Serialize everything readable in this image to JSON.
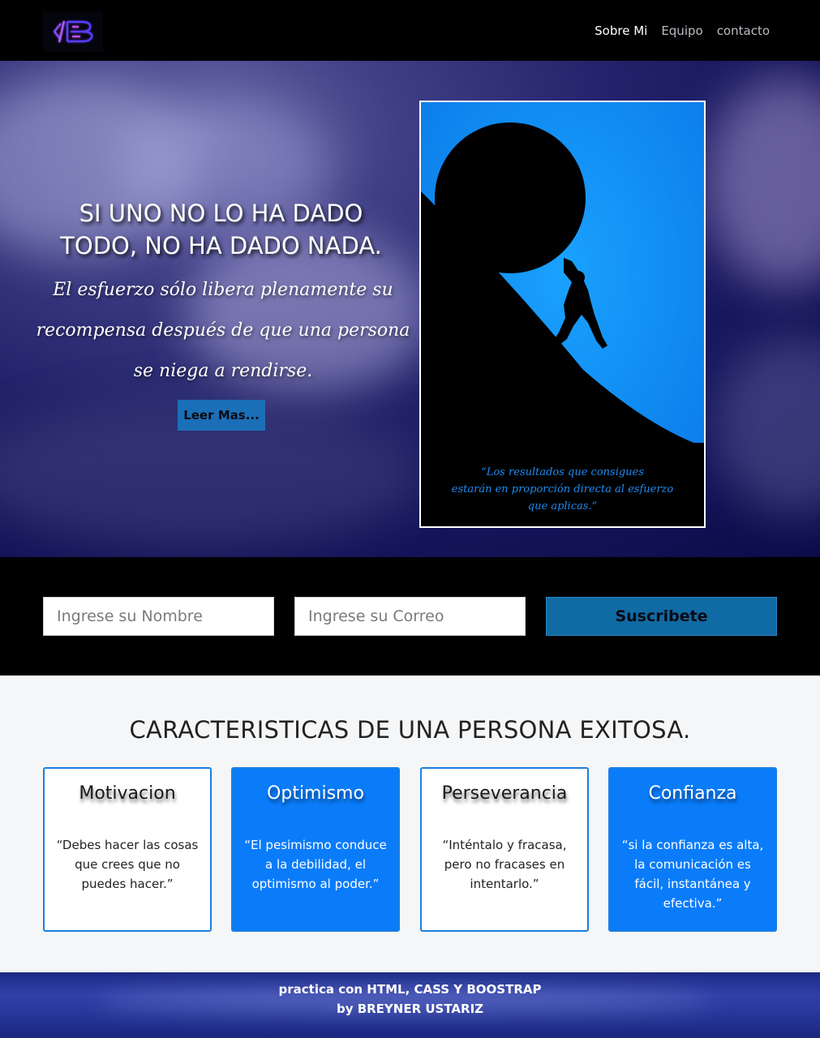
{
  "nav": {
    "logo_alt": "logo-icon",
    "links": [
      "Sobre Mi",
      "Equipo",
      "contacto"
    ]
  },
  "hero": {
    "title_line1": "SI UNO NO LO HA DADO",
    "title_line2": "TODO, NO HA DADO NADA.",
    "sub_line1": "El esfuerzo sólo libera plenamente su",
    "sub_line2": "recompensa después de que una persona",
    "sub_line3": "se niega a rendirse.",
    "button": "Leer Mas..."
  },
  "poster": {
    "quote_line1": "“Los resultados que consigues",
    "quote_line2": "estarán en proporción directa al esfuerzo",
    "quote_line3": "que aplicas.”"
  },
  "subscribe": {
    "name_placeholder": "Ingrese su Nombre",
    "email_placeholder": "Ingrese su Correo",
    "button": "Suscribete"
  },
  "features": {
    "title": "CARACTERISTICAS DE UNA PERSONA EXITOSA.",
    "cards": [
      {
        "title": "Motivacion",
        "text": "“Debes hacer las cosas que crees que no puedes hacer.”"
      },
      {
        "title": "Optimismo",
        "text": "“El pesimismo conduce a la debilidad, el optimismo al poder.”"
      },
      {
        "title": "Perseverancia",
        "text": "“Inténtalo y fracasa, pero no fracases en intentarlo.”"
      },
      {
        "title": "Confianza",
        "text": "“si la confianza es alta, la comunicación es fácil, instantánea y efectiva.”"
      }
    ]
  },
  "footer": {
    "line1": "practica con HTML, CASS Y BOOSTRAP",
    "line2": "by BREYNER USTARIZ"
  },
  "colors": {
    "nav_bg": "#000000",
    "accent_blue": "#0a7cfa",
    "button_blue": "#106aa3"
  }
}
